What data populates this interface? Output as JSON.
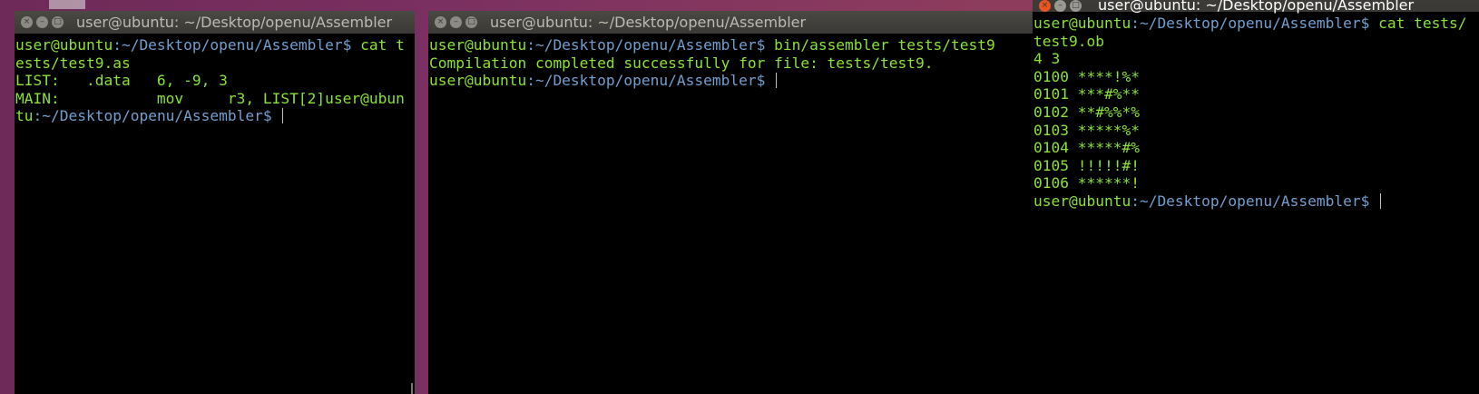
{
  "windows": {
    "left": {
      "title": "user@ubuntu: ~/Desktop/openu/Assembler",
      "prompt_user": "user@ubuntu",
      "prompt_path": ":~/Desktop/openu/Assembler$",
      "command_part1": " cat t",
      "command_part2": "ests/test9.as",
      "line_list": "LIST:   .data   6, -9, 3",
      "line_main": "MAIN:           mov     r3, LIST[2]",
      "prompt2_user_a": "user@ubun",
      "prompt2_user_b": "tu",
      "prompt2_path": ":~/Desktop/openu/Assembler$"
    },
    "middle": {
      "title": "user@ubuntu: ~/Desktop/openu/Assembler",
      "prompt_user": "user@ubuntu",
      "prompt_path": ":~/Desktop/openu/Assembler$",
      "command": " bin/assembler tests/test9",
      "output": "Compilation completed successfully for file: tests/test9.",
      "prompt2_user": "user@ubuntu",
      "prompt2_path": ":~/Desktop/openu/Assembler$"
    },
    "right": {
      "title": "user@ubuntu: ~/Desktop/openu/Assembler",
      "prompt_user": "user@ubuntu",
      "prompt_path": ":~/Desktop/openu/Assembler$",
      "command_part1": " cat tests/",
      "command_part2": "test9.ob",
      "output_lines": [
        "4 3",
        "0100 ****!%*",
        "0101 ***#%**",
        "0102 **#%%*%",
        "0103 *****%*",
        "0104 *****#%",
        "0105 !!!!!#!",
        "0106 ******!"
      ],
      "prompt2_user": "user@ubuntu",
      "prompt2_path": ":~/Desktop/openu/Assembler$"
    }
  },
  "icons": {
    "close": "close-icon",
    "minimize": "minimize-icon",
    "maximize": "maximize-icon"
  },
  "colors": {
    "terminal_green": "#8ae234",
    "terminal_bg": "#000000",
    "close_active": "#e95420"
  }
}
